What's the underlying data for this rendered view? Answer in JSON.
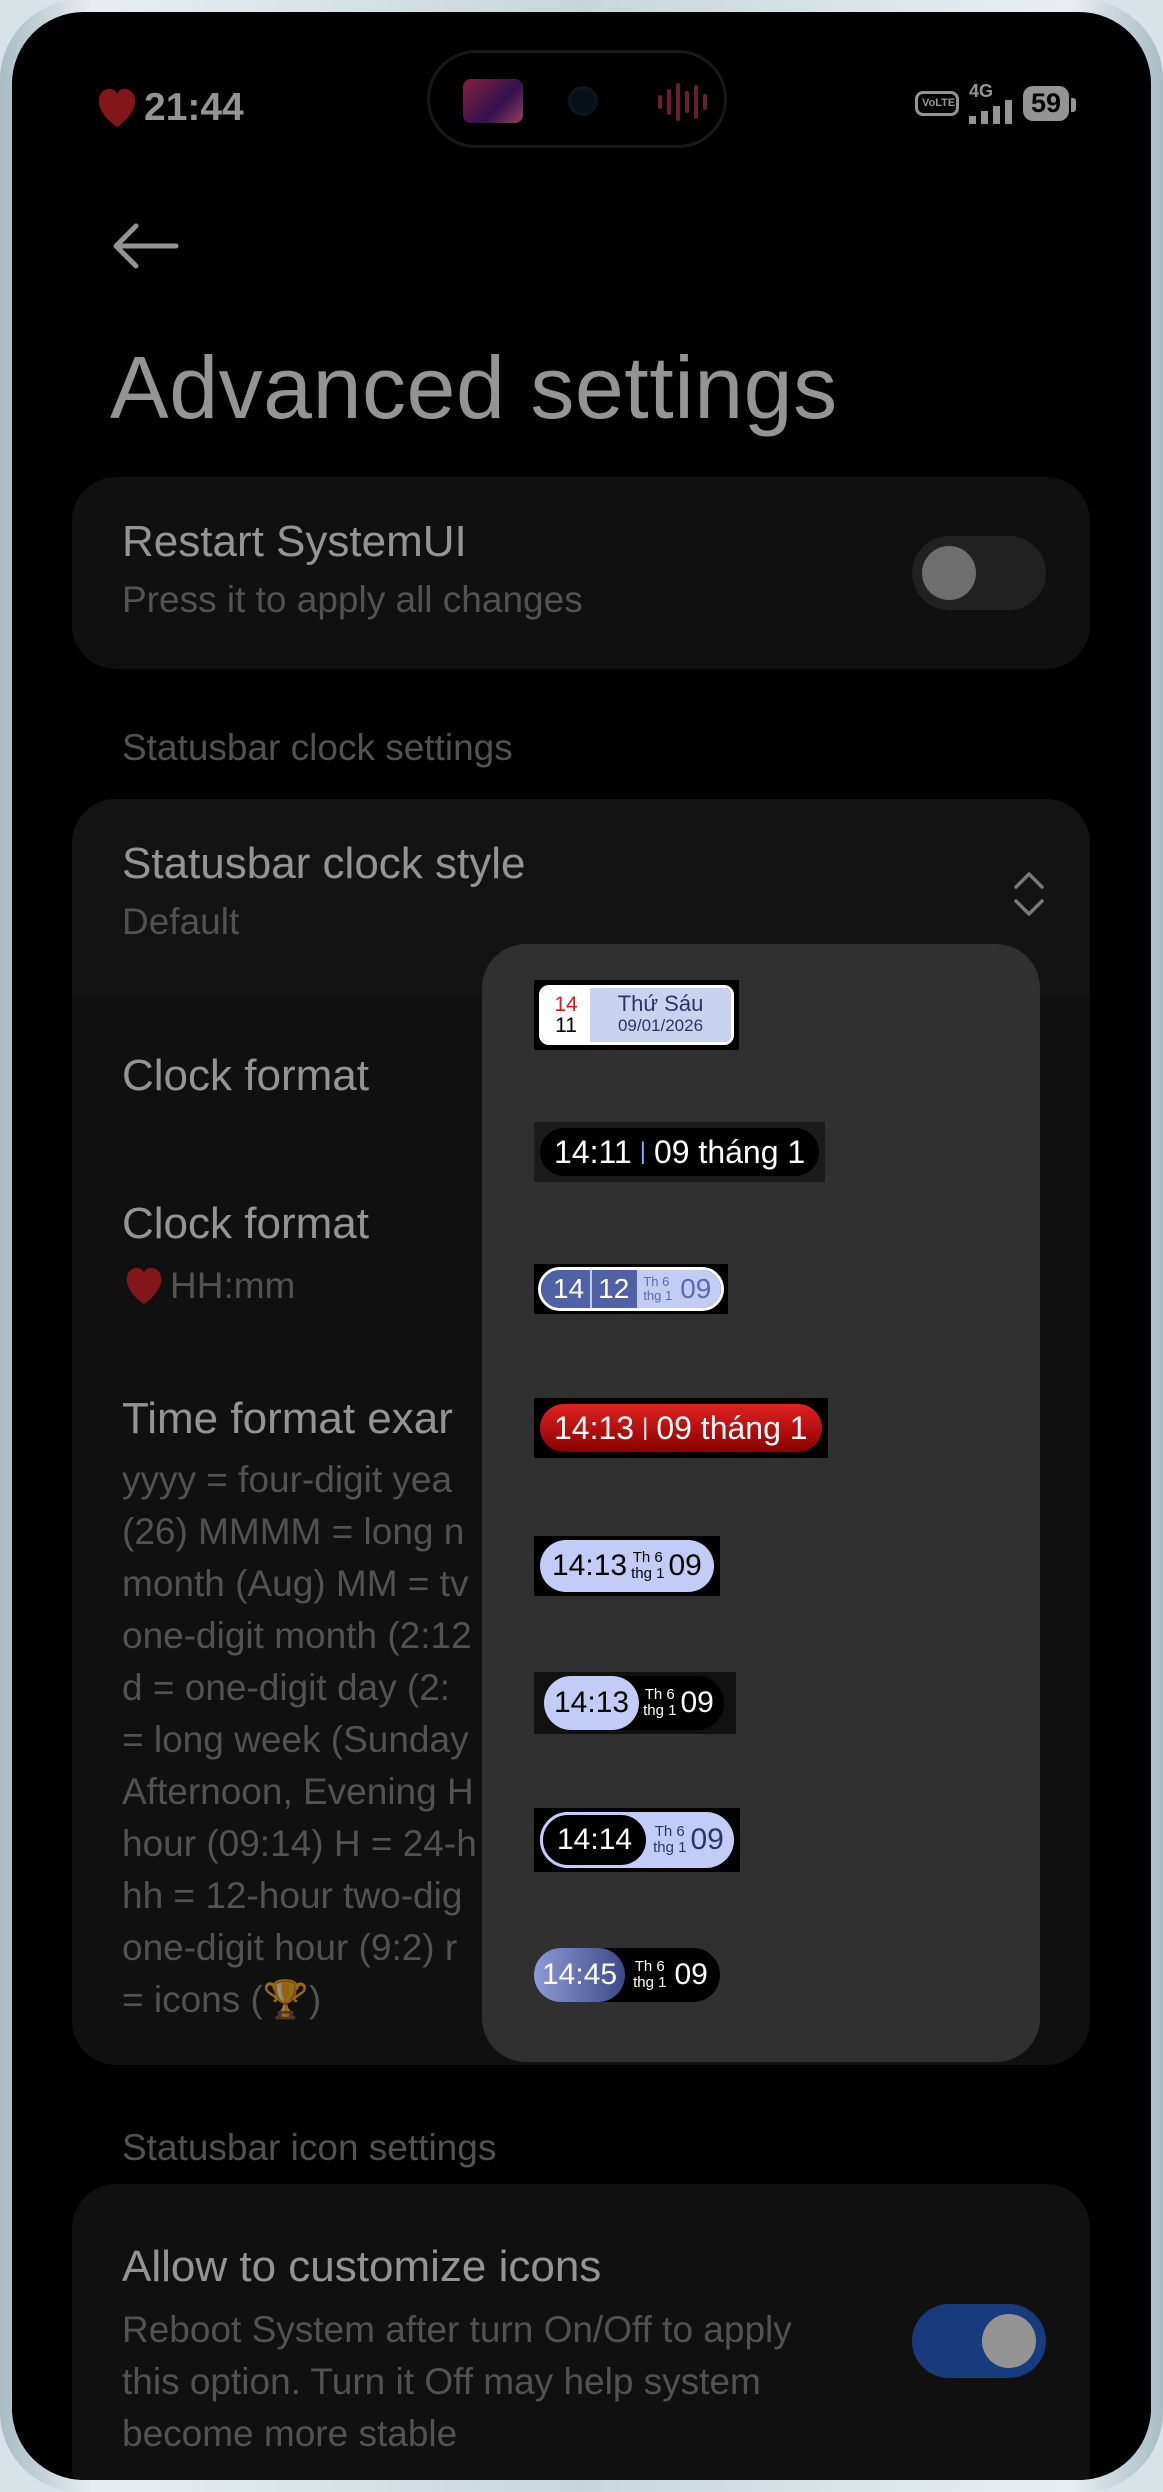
{
  "status_bar": {
    "time": "21:44",
    "network": "4G",
    "volte": "VoLTE",
    "battery": "59",
    "icons": [
      "heart-icon",
      "signal-icon",
      "battery-icon"
    ]
  },
  "header": {
    "back_icon": "arrow-left-icon",
    "title": "Advanced settings"
  },
  "restart": {
    "title": "Restart SystemUI",
    "subtitle": "Press it to apply all changes",
    "toggle_on": false
  },
  "clock_section": {
    "header": "Statusbar clock settings",
    "style_title": "Statusbar clock style",
    "style_value": "Default",
    "clock_format_1": "Clock format",
    "clock_format_2_title": "Clock format",
    "clock_format_2_value": "HH:mm",
    "time_format_title": "Time format exar",
    "time_format_lines": [
      "yyyy = four-digit yea",
      "(26) MMMM = long n",
      "month (Aug) MM = tv",
      "one-digit month (2:12",
      "d = one-digit day (2:",
      "= long week (Sunday",
      "Afternoon, Evening H",
      "hour (09:14) H = 24-h",
      "hh = 12-hour two-dig",
      "one-digit hour (9:2) r",
      "= icons (🏆)"
    ]
  },
  "icon_section": {
    "header": "Statusbar icon settings",
    "title": "Allow to customize icons",
    "desc_lines": [
      "Reboot System after turn On/Off to apply",
      "this option. Turn it Off may help system",
      "become more stable"
    ],
    "toggle_on": true
  },
  "dropdown": {
    "options": [
      {
        "date_top": "14",
        "date_bottom": "11",
        "weekday": "Thứ Sáu",
        "date": "09/01/2026"
      },
      {
        "time": "14:11",
        "separator": "|",
        "date": "09 tháng 1"
      },
      {
        "hour": "14",
        "minute": "12",
        "weekday": "Th 6",
        "month": "thg 1",
        "day": "09"
      },
      {
        "time": "14:13",
        "separator": "|",
        "date": "09 tháng 1"
      },
      {
        "time": "14:13",
        "weekday": "Th 6",
        "month": "thg 1",
        "day": "09"
      },
      {
        "time": "14:13",
        "weekday": "Th 6",
        "month": "thg 1",
        "day": "09"
      },
      {
        "time": "14:14",
        "weekday": "Th 6",
        "month": "thg 1",
        "day": "09"
      },
      {
        "time": "14:45",
        "weekday": "Th 6",
        "month": "thg 1",
        "day": "09"
      }
    ]
  },
  "colors": {
    "accent": "#2a66d9",
    "heart": "#e0262f",
    "card": "#1c1c1c",
    "popup": "#303030"
  }
}
